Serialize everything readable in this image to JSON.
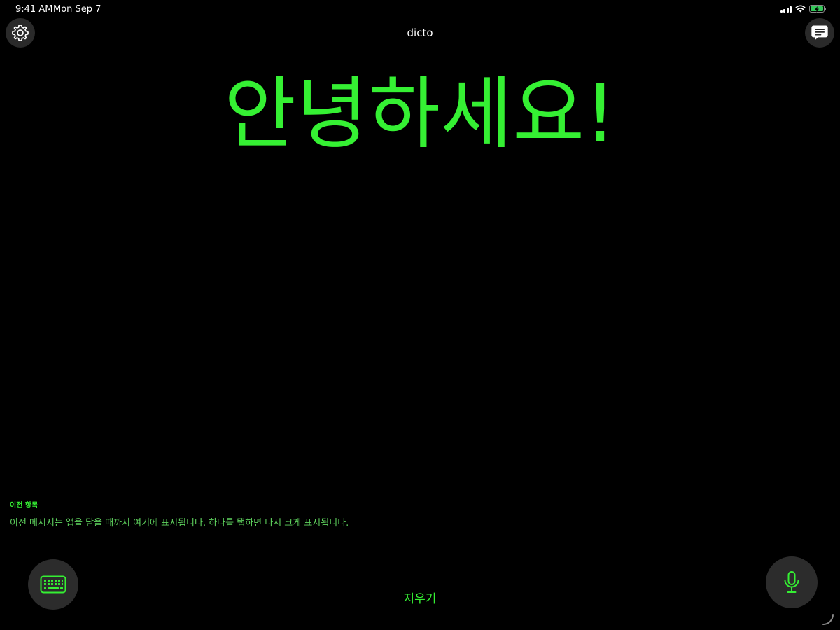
{
  "status_bar": {
    "time": "9:41 AM",
    "date": "Mon Sep 7",
    "icons": [
      "signal-icon",
      "wifi-icon",
      "battery-charging-icon"
    ]
  },
  "header": {
    "title": "dicto",
    "settings_icon": "gear-icon",
    "history_icon": "chat-bubble-icon"
  },
  "main": {
    "message": "안녕하세요!"
  },
  "history": {
    "heading": "이전 항목",
    "note": "이전 메시지는 앱을 닫을 때까지 여기에 표시됩니다. 하나를 탭하면 다시 크게 표시됩니다."
  },
  "bottom_bar": {
    "keyboard_icon": "keyboard-icon",
    "clear_label": "지우기",
    "mic_icon": "microphone-icon"
  },
  "colors": {
    "background": "#000000",
    "accent": "#35f033",
    "button_bg": "#2c2c2c",
    "battery": "#34c759"
  }
}
